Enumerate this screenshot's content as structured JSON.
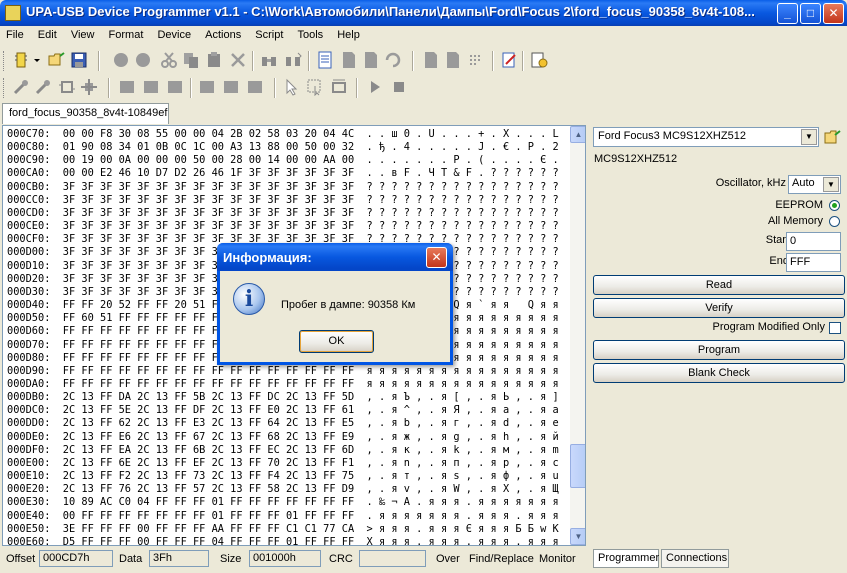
{
  "window": {
    "title": "UPA-USB Device Programmer v1.1  - C:\\Work\\Автомобили\\Панели\\Дампы\\Ford\\Focus 2\\ford_focus_90358_8v4t-108...",
    "minimize": "_",
    "maximize": "□",
    "close": "✕"
  },
  "menu": [
    "File",
    "Edit",
    "View",
    "Format",
    "Device",
    "Actions",
    "Script",
    "Tools",
    "Help"
  ],
  "document_tab": "ford_focus_90358_8v4t-10849ef",
  "hex_lines": [
    "000C70:  00 00 F8 30 08 55 00 00 04 2B 02 58 03 20 04 4C  . . ш 0 . U . . . + . X . . . L",
    "000C80:  01 90 08 34 01 0B 0C 1C 00 A3 13 88 00 50 00 32  . ђ . 4 . . . . . Ј . € . P . 2",
    "000C90:  00 19 00 0A 00 00 00 50 00 28 00 14 00 00 AA 00  . . . . . . . P . ( . . . . Є .",
    "000CA0:  00 00 E2 46 10 D7 D2 26 46 1F 3F 3F 3F 3F 3F 3F  . . в F . Ч Т & F . ? ? ? ? ? ?",
    "000CB0:  3F 3F 3F 3F 3F 3F 3F 3F 3F 3F 3F 3F 3F 3F 3F 3F  ? ? ? ? ? ? ? ? ? ? ? ? ? ? ? ?",
    "000CC0:  3F 3F 3F 3F 3F 3F 3F 3F 3F 3F 3F 3F 3F 3F 3F 3F  ? ? ? ? ? ? ? ? ? ? ? ? ? ? ? ?",
    "000CD0:  3F 3F 3F 3F 3F 3F 3F 3F 3F 3F 3F 3F 3F 3F 3F 3F  ? ? ? ? ? ? ? ? ? ? ? ? ? ? ? ?",
    "000CE0:  3F 3F 3F 3F 3F 3F 3F 3F 3F 3F 3F 3F 3F 3F 3F 3F  ? ? ? ? ? ? ? ? ? ? ? ? ? ? ? ?",
    "000CF0:  3F 3F 3F 3F 3F 3F 3F 3F 3F 3F 3F 3F 3F 3F 3F 3F  ? ? ? ? ? ? ? ? ? ? ? ? ? ? ? ?",
    "000D00:  3F 3F 3F 3F 3F 3F 3F 3F 3F 3F 3F 3F 3F 3F 3F 3F  ? ? ? ? ? ? ? ? ? ? ? ? ? ? ? ?",
    "000D10:  3F 3F 3F 3F 3F 3F 3F 3F 3F 3F 3F 3F 3F 3F 3F 3F  ? ? ? ? ? ? ? ? ? ? ? ? ? ? ? ?",
    "000D20:  3F 3F 3F 3F 3F 3F 3F 3F 3F 3F 3F 3F 3F 3F 3F 3F  ? ? ? ? ? ? ? ? ? ? ? ? ? ? ? ?",
    "000D30:  3F 3F 3F 3F 3F 3F 3F 3F 3F 3F 3F 3F 3F 3F 3F 3F  ? ? ? ? ? ? ? ? ? ? ? ? ? ? ? ?",
    "000D40:  FF FF 20 52 FF FF 20 51 FF 60 FF FF 20 51 FF FF  я я   R я я   Q я ` я я   Q я я",
    "000D50:  FF 60 51 FF FF FF FF FF FF FF FF FF FF FF FF FF  я ` Q я я я я я я я я я я я я я",
    "000D60:  FF FF FF FF FF FF FF FF FF FF FF FF FF FF FF FF  я я я я я я я я я я я я я я я я",
    "000D70:  FF FF FF FF FF FF FF FF FF FF FF FF FF FF FF FF  я я я я я я я я я я я я я я я я",
    "000D80:  FF FF FF FF FF FF FF FF FF FF FF FF FF FF FF FF  я я я я я я я я я я я я я я я я",
    "000D90:  FF FF FF FF FF FF FF FF FF FF FF FF FF FF FF FF  я я я я я я я я я я я я я я я я",
    "000DA0:  FF FF FF FF FF FF FF FF FF FF FF FF FF FF FF FF  я я я я я я я я я я я я я я я я",
    "000DB0:  2C 13 FF DA 2C 13 FF 5B 2C 13 FF DC 2C 13 FF 5D  , . я Ъ , . я [ , . я Ь , . я ]",
    "000DC0:  2C 13 FF 5E 2C 13 FF DF 2C 13 FF E0 2C 13 FF 61  , . я ^ , . я Я , . я а , . я a",
    "000DD0:  2C 13 FF 62 2C 13 FF E3 2C 13 FF 64 2C 13 FF E5  , . я b , . я г , . я d , . я е",
    "000DE0:  2C 13 FF E6 2C 13 FF 67 2C 13 FF 68 2C 13 FF E9  , . я ж , . я g , . я h , . я й",
    "000DF0:  2C 13 FF EA 2C 13 FF 6B 2C 13 FF EC 2C 13 FF 6D  , . я к , . я k , . я м , . я m",
    "000E00:  2C 13 FF 6E 2C 13 FF EF 2C 13 FF 70 2C 13 FF F1  , . я n , . я п , . я p , . я с",
    "000E10:  2C 13 FF F2 2C 13 FF 73 2C 13 FF F4 2C 13 FF 75  , . я т , . я s , . я ф , . я u",
    "000E20:  2C 13 FF 76 2C 13 FF 57 2C 13 FF 58 2C 13 FF D9  , . я v , . я W , . я X , . я Щ",
    "000E30:  10 89 AC C0 04 FF FF FF 01 FF FF FF FF FF FF FF  . ‰ ¬ А . я я я . я я я я я я я",
    "000E40:  00 FF FF FF FF FF FF FF 01 FF FF FF 01 FF FF FF  . я я я я я я я . я я я . я я я",
    "000E50:  3E FF FF FF 00 FF FF FF AA FF FF FF C1 C1 77 CA  > я я я . я я я Є я я я Б Б w К",
    "000E60:  D5 FF FF FF 00 FF FF FF 04 FF FF FF 01 FF FF FF  Х я я я . я я я . я я я . я я я"
  ],
  "status": {
    "offset_label": "Offset",
    "offset_value": "000CD7h",
    "data_label": "Data",
    "data_value": "3Fh",
    "size_label": "Size",
    "size_value": "001000h",
    "crc_label": "CRC",
    "crc_value": "",
    "over_label": "Over",
    "find_replace": "Find/Replace",
    "monitor": "Monitor"
  },
  "right": {
    "device_select": "Ford Focus3 MC9S12XHZ512",
    "chip_name": "MC9S12XHZ512",
    "oscillator_label": "Oscillator, kHz",
    "oscillator_value": "Auto",
    "eeprom_label": "EEPROM",
    "all_memory_label": "All Memory",
    "start_label": "Start",
    "start_value": "0",
    "end_label": "End",
    "end_value": "FFF",
    "read_button": "Read",
    "verify_button": "Verify",
    "program_modified_only": "Program Modified Only",
    "program_button": "Program",
    "blank_check_button": "Blank Check"
  },
  "bottom_tabs": [
    "Programmer",
    "Connections"
  ],
  "dialog": {
    "title": "Информация:",
    "message": "Пробег в дампе: 90358 Км",
    "ok": "OK",
    "icon": "i"
  }
}
